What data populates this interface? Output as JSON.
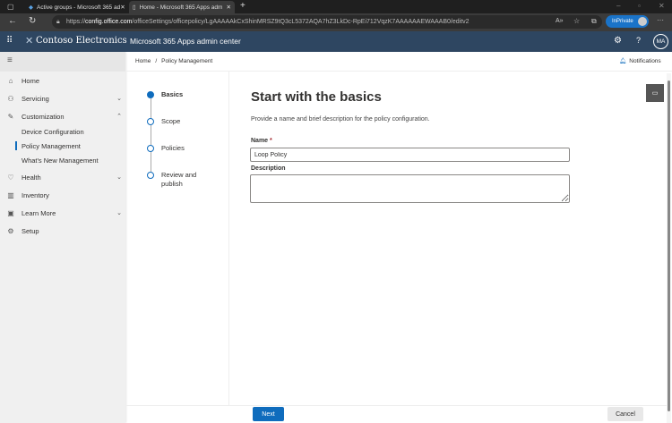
{
  "browser": {
    "tabs": [
      {
        "label": "Active groups - Microsoft 365 ad"
      },
      {
        "label": "Home - Microsoft 365 Apps adm"
      }
    ],
    "url_prefix": "https://",
    "url_domain": "config.office.com",
    "url_path": "/officeSettings/officepolicy/LgAAAAAkCxShinMRSZ9tQ3cL5372AQA7hZ3LkDc-RpEi712VqzK7AAAAAAEWAAAB0/editv2",
    "inprivate": "InPrivate"
  },
  "header": {
    "brand": "Contoso Electronics",
    "app_title": "Microsoft 365 Apps admin center",
    "avatar": "MA"
  },
  "sidebar": {
    "items": [
      {
        "label": "Home"
      },
      {
        "label": "Servicing"
      },
      {
        "label": "Customization"
      },
      {
        "label": "Health"
      },
      {
        "label": "Inventory"
      },
      {
        "label": "Learn More"
      },
      {
        "label": "Setup"
      }
    ],
    "subitems": [
      {
        "label": "Device Configuration"
      },
      {
        "label": "Policy Management"
      },
      {
        "label": "What's New Management"
      }
    ]
  },
  "breadcrumb": {
    "home": "Home",
    "sep": "/",
    "current": "Policy Management"
  },
  "notifications": "Notifications",
  "steps": [
    {
      "label": "Basics"
    },
    {
      "label": "Scope"
    },
    {
      "label": "Policies"
    },
    {
      "label": "Review and publish"
    }
  ],
  "form": {
    "title": "Start with the basics",
    "description": "Provide a name and brief description for the policy configuration.",
    "name_label": "Name",
    "required_mark": "*",
    "name_value": "Loop Policy",
    "description_label": "Description",
    "description_value": ""
  },
  "footer": {
    "next": "Next",
    "cancel": "Cancel"
  }
}
